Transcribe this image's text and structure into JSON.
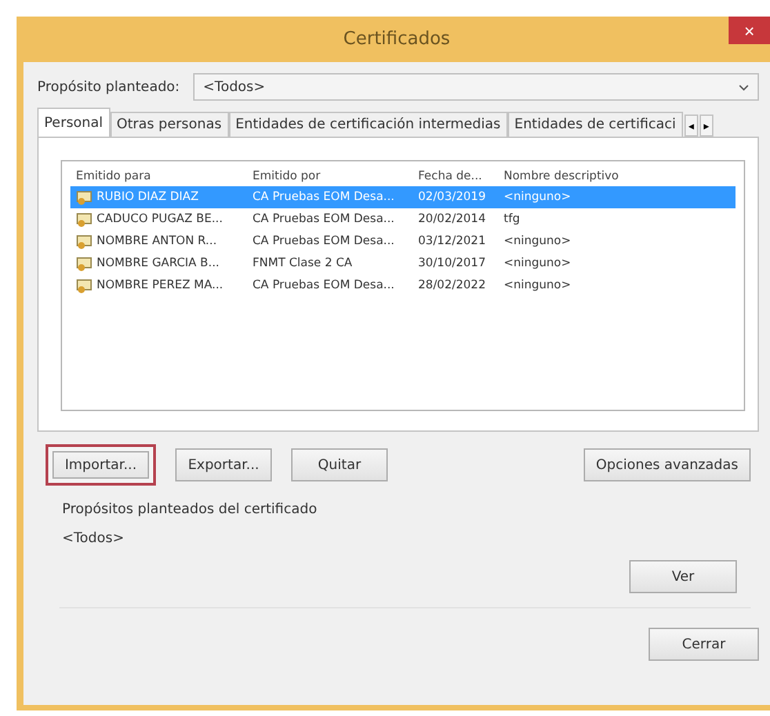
{
  "window": {
    "title": "Certificados",
    "close": "×"
  },
  "purpose": {
    "label": "Propósito planteado:",
    "value": "<Todos>"
  },
  "tabs": [
    {
      "label": "Personal",
      "selected": true
    },
    {
      "label": "Otras personas",
      "selected": false
    },
    {
      "label": "Entidades de certificación intermedias",
      "selected": false
    },
    {
      "label": "Entidades de certificaci",
      "selected": false
    }
  ],
  "tab_scroll": [
    "◂",
    "▸"
  ],
  "table": {
    "columns": [
      "Emitido para",
      "Emitido por",
      "Fecha de...",
      "Nombre descriptivo"
    ],
    "rows": [
      {
        "cells": [
          "RUBIO DIAZ DIAZ",
          "CA Pruebas EOM Desa...",
          "02/03/2019",
          "<ninguno>"
        ],
        "selected": true
      },
      {
        "cells": [
          "CADUCO PUGAZ BE...",
          "CA Pruebas EOM Desa...",
          "20/02/2014",
          "tfg"
        ],
        "selected": false
      },
      {
        "cells": [
          "NOMBRE ANTON R...",
          "CA Pruebas EOM Desa...",
          "03/12/2021",
          "<ninguno>"
        ],
        "selected": false
      },
      {
        "cells": [
          "NOMBRE GARCIA B...",
          "FNMT Clase 2 CA",
          "30/10/2017",
          "<ninguno>"
        ],
        "selected": false
      },
      {
        "cells": [
          "NOMBRE PEREZ MA...",
          "CA Pruebas EOM Desa...",
          "28/02/2022",
          "<ninguno>"
        ],
        "selected": false
      }
    ]
  },
  "actions": [
    {
      "label": "Importar...",
      "highlighted": true
    },
    {
      "label": "Exportar...",
      "highlighted": false
    },
    {
      "label": "Quitar",
      "highlighted": false
    }
  ],
  "advanced_button": "Opciones avanzadas",
  "purposes_group": {
    "title": "Propósitos planteados del certificado",
    "value": "<Todos>",
    "button": "Ver"
  },
  "close_button": "Cerrar"
}
